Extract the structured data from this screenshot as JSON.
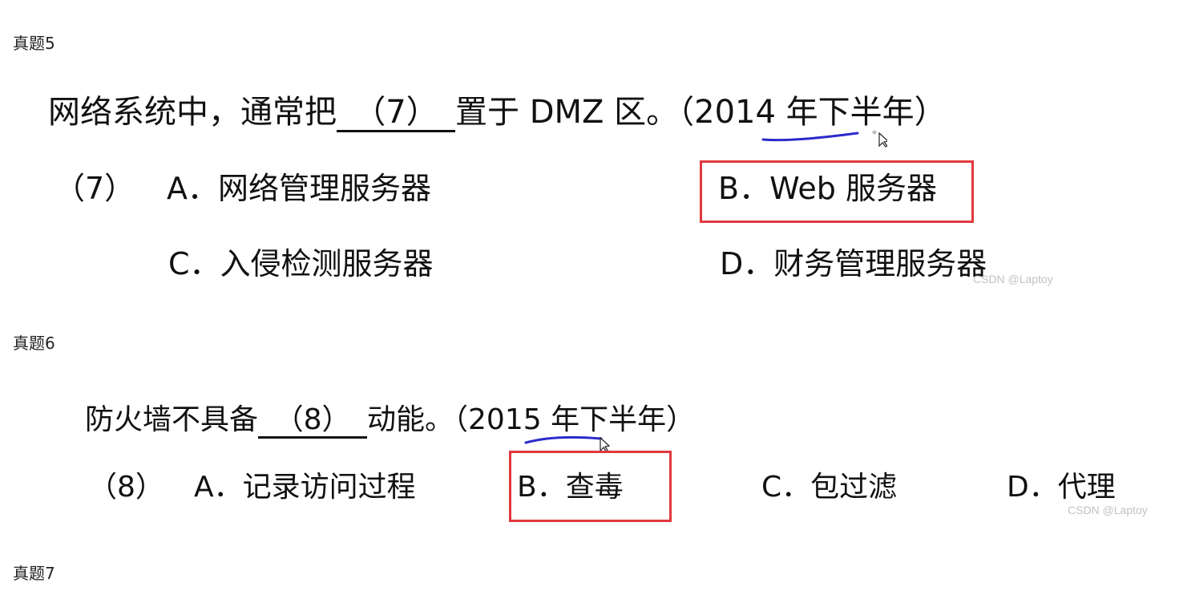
{
  "sections": [
    {
      "heading": "真题5",
      "question": {
        "before": "网络系统中，通常把",
        "blank": "（7）",
        "after": "置于 DMZ 区。（2014 年下半年）"
      },
      "option_group_label": "（7）",
      "options": [
        {
          "letter": "A．",
          "text": "网络管理服务器"
        },
        {
          "letter": "B．",
          "text": "Web 服务器"
        },
        {
          "letter": "C．",
          "text": "入侵检测服务器"
        },
        {
          "letter": "D．",
          "text": "财务管理服务器"
        }
      ],
      "correct_option": "B",
      "watermark": "CSDN @Laptoy"
    },
    {
      "heading": "真题6",
      "question": {
        "before": "防火墙不具备",
        "blank": "（8）",
        "after": "动能。（2015 年下半年）"
      },
      "option_group_label": "（8）",
      "options": [
        {
          "letter": "A．",
          "text": "记录访问过程"
        },
        {
          "letter": "B．",
          "text": "查毒"
        },
        {
          "letter": "C．",
          "text": "包过滤"
        },
        {
          "letter": "D．",
          "text": "代理"
        }
      ],
      "correct_option": "B",
      "watermark": "CSDN @Laptoy"
    },
    {
      "heading": "真题7"
    }
  ],
  "colors": {
    "answer_box": "#e0393e",
    "ink_underline": "#2a2acc",
    "watermark": "#c2c2c2"
  }
}
